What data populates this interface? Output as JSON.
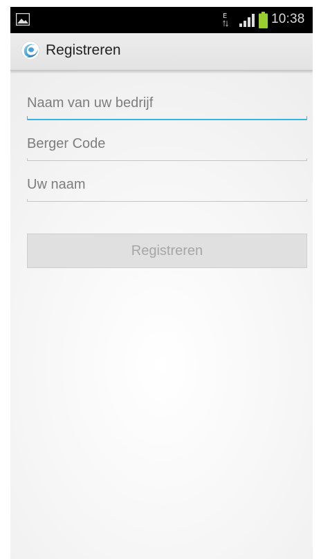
{
  "status_bar": {
    "time": "10:38",
    "network_letter": "E",
    "icons": [
      "gallery-notification-icon",
      "edge-data-icon",
      "signal-strength-icon",
      "battery-icon"
    ],
    "battery_color": "#9acd32"
  },
  "action_bar": {
    "title": "Registreren",
    "app_icon": "app-logo-icon"
  },
  "form": {
    "company_name": {
      "placeholder": "Naam van uw bedrijf",
      "value": "",
      "focused": true
    },
    "berger_code": {
      "placeholder": "Berger Code",
      "value": ""
    },
    "user_name": {
      "placeholder": "Uw naam",
      "value": ""
    },
    "submit_label": "Registreren",
    "submit_enabled": false
  },
  "colors": {
    "accent": "#33b5e5",
    "status_bar_bg": "#000000",
    "action_bar_bg": "#e8e8e8",
    "disabled_text": "#a6a6a6"
  }
}
